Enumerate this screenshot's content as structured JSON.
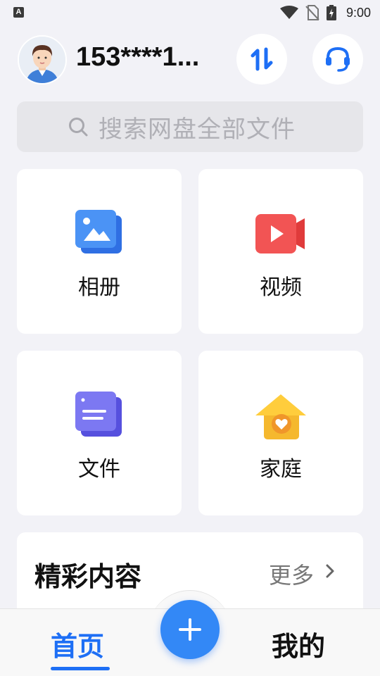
{
  "status_bar": {
    "notification_letter": "A",
    "icons": [
      "wifi-icon",
      "no-sim-icon",
      "battery-charging-icon"
    ],
    "time": "9:00"
  },
  "header": {
    "username": "153****1...",
    "avatar_icon": "avatar-icon",
    "transfer_icon": "transfer-arrows-icon",
    "service_icon": "headset-icon"
  },
  "search": {
    "placeholder": "搜索网盘全部文件",
    "icon": "search-icon"
  },
  "categories": [
    {
      "label": "相册",
      "icon": "album-icon",
      "color": "#3b82f6"
    },
    {
      "label": "视频",
      "icon": "video-icon",
      "color": "#f04a4a"
    },
    {
      "label": "文件",
      "icon": "file-icon",
      "color": "#6a64ee"
    },
    {
      "label": "家庭",
      "icon": "home-heart-icon",
      "color": "#f5b82e"
    }
  ],
  "featured": {
    "title": "精彩内容",
    "more_label": "更多"
  },
  "bottom_nav": {
    "home_label": "首页",
    "mine_label": "我的",
    "add_icon": "plus-icon",
    "active_color": "#1e6ff5"
  }
}
